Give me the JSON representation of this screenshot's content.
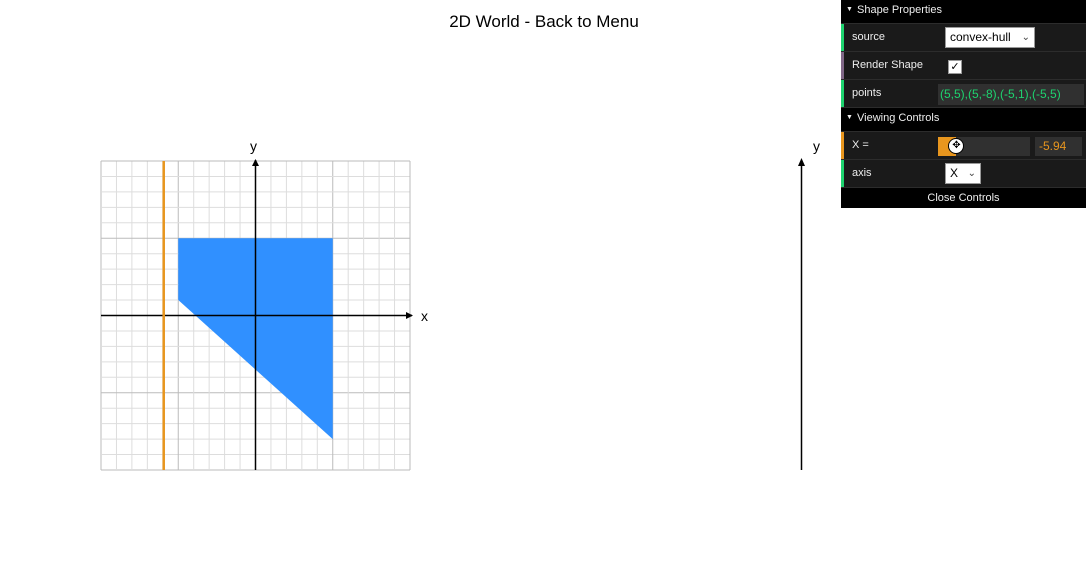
{
  "header": {
    "title": "2D World - Back to Menu"
  },
  "colors": {
    "shape_fill": "#3090ff",
    "cutline": "#e8961e",
    "grid": "#dddddd",
    "axis": "#000000",
    "panel_bg": "#1a1a1a",
    "accent_green": "#1ed36f",
    "accent_orange": "#e8961e"
  },
  "left_plot": {
    "x_axis_label": "x",
    "y_axis_label": "y",
    "x_range": [
      -10,
      10
    ],
    "y_range": [
      -10,
      10
    ],
    "shape_points": [
      [
        5,
        5
      ],
      [
        5,
        -8
      ],
      [
        -5,
        1
      ],
      [
        -5,
        5
      ]
    ],
    "cut_x": -5.94
  },
  "right_plot": {
    "y_axis_label": "y"
  },
  "gui": {
    "shape_folder": {
      "title": "Shape Properties",
      "source_label": "source",
      "source_value": "convex-hull",
      "render_label": "Render Shape",
      "render_checked": true,
      "points_label": "points",
      "points_value": "(5,5),(5,-8),(-5,1),(-5,5)"
    },
    "view_folder": {
      "title": "Viewing Controls",
      "x_label": "X =",
      "x_value": "-5.94",
      "x_fraction": 0.2,
      "axis_label": "axis",
      "axis_value": "X"
    },
    "close_label": "Close Controls"
  }
}
